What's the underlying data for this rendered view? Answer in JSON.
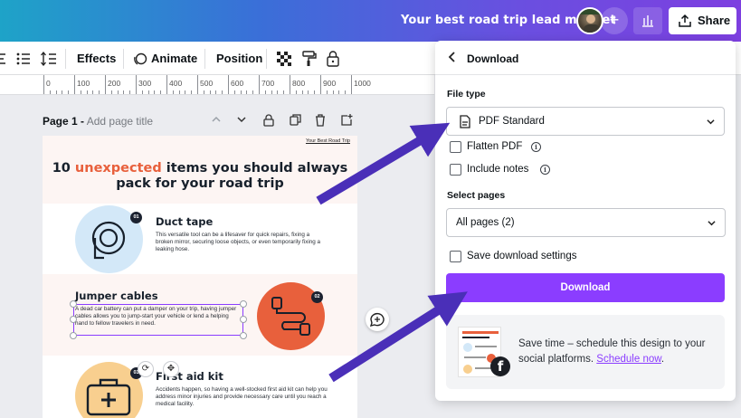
{
  "header": {
    "doc_title": "Your best road trip lead magnet",
    "plus_label": "+",
    "share_label": "Share"
  },
  "toolbar": {
    "effects": "Effects",
    "animate": "Animate",
    "position": "Position"
  },
  "ruler": {
    "labels": [
      "0",
      "100",
      "200",
      "300",
      "400",
      "500",
      "600",
      "700",
      "800",
      "900",
      "1000"
    ]
  },
  "canvas": {
    "page_label": "Page 1 -",
    "page_title_placeholder": "Add page title"
  },
  "design": {
    "tag": "Your Best Road Trip",
    "headline_pre": "10 ",
    "headline_highlight": "unexpected",
    "headline_post": " items you should always pack for your road trip",
    "items": [
      {
        "num": "01",
        "title": "Duct tape",
        "body": "This versatile tool can be a lifesaver for quick repairs, fixing a broken mirror, securing loose objects, or even temporarily fixing a leaking hose."
      },
      {
        "num": "02",
        "title": "Jumper cables",
        "body": "A dead car battery can put a damper on your trip, having jumper cables allows you to jump-start your vehicle or lend a helping hand to fellow travelers in need."
      },
      {
        "num": "03",
        "title": "First aid kit",
        "body": "Accidents happen, so having a well-stocked first aid kit can help you address minor injuries and provide necessary care until you reach a medical facility."
      }
    ],
    "colors": {
      "blue_circle": "#d3e8f8",
      "coral_circle": "#e8603c",
      "yellow_circle": "#f8cf8f",
      "highlight": "#e8603c"
    }
  },
  "download_panel": {
    "title": "Download",
    "file_type_label": "File type",
    "file_type_value": "PDF Standard",
    "flatten_pdf": "Flatten PDF",
    "include_notes": "Include notes",
    "select_pages_label": "Select pages",
    "select_pages_value": "All pages (2)",
    "save_settings": "Save download settings",
    "download_button": "Download",
    "promo_text": "Save time – schedule this design to your social platforms.",
    "promo_link": "Schedule now",
    "promo_suffix": ".",
    "accent": "#8b3dff"
  }
}
